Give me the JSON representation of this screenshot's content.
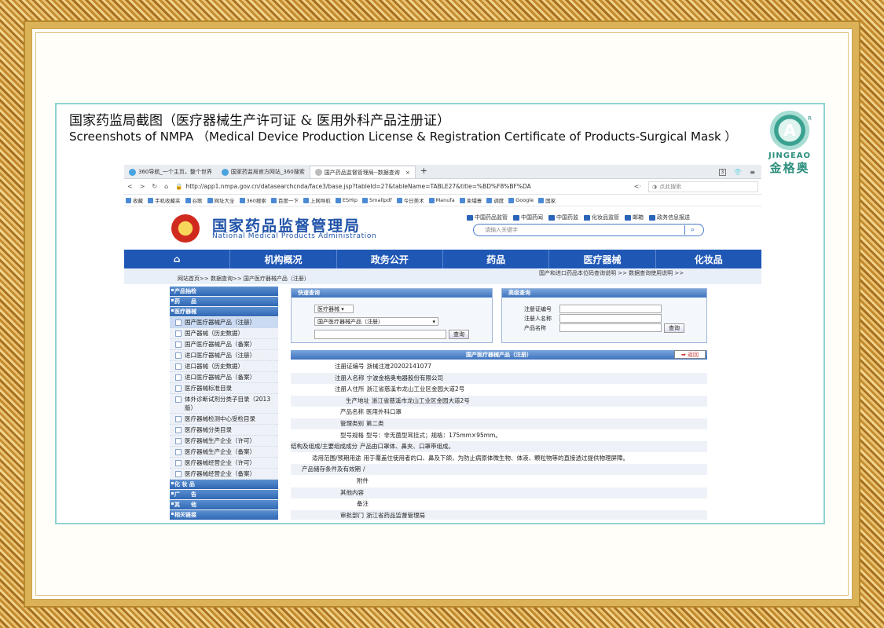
{
  "caption": {
    "cn": "国家药监局截图（医疗器械生产许可证 & 医用外科产品注册证）",
    "en": "Screenshots of NMPA （Medical Device Production License & Registration Certificate of Products-Surgical Mask ）"
  },
  "logo": {
    "en": "JINGEAO",
    "cn": "金格奥",
    "mark": "R"
  },
  "browser": {
    "tabs": [
      "360导航_一个主页，整个世界",
      "国家药监局官方网站_360搜索",
      "国产药品监督管理局--数据查询"
    ],
    "tab_close": "×",
    "tab_new": "+",
    "tab_count": "3",
    "url": "http://app1.nmpa.gov.cn/datasearchcnda/face3/base.jsp?tableId=27&tableName=TABLE27&title=%BD%F8%BF%DA",
    "search_placeholder": "点此搜索",
    "bookmarks": [
      "收藏",
      "手机收藏夹",
      "谷歌",
      "网址大全",
      "360搜索",
      "百度一下",
      "上网导航",
      "ESHip",
      "Smallpdf",
      "今日美术",
      "Manufa",
      "柬埔寨",
      "调度",
      "Google",
      "国家"
    ]
  },
  "site": {
    "title": "国家药品监督管理局",
    "subtitle": "National Medical Products Administration",
    "quick_links": [
      "中国药品监管",
      "中国药闻",
      "中国药监",
      "化妆品监管",
      "邮箱",
      "政务信息报送"
    ],
    "search_placeholder": "请输入关键字",
    "nav": [
      "⌂",
      "机构概况",
      "政务公开",
      "药品",
      "医疗器械",
      "化妆品"
    ],
    "breadcrumb": "网站首页>> 数据查询>> 国产医疗器械产品（注册）",
    "right_links": "国产和进口药品本位码查询说明 >>      数据查询使用说明 >>"
  },
  "sidebar": {
    "sections": [
      {
        "head": "产品抽检",
        "items": []
      },
      {
        "head": "药　　品",
        "items": []
      },
      {
        "head": "医疗器械",
        "items": [
          "国产医疗器械产品（注册）",
          "国产器械（历史数据）",
          "国产医疗器械产品（备案）",
          "进口医疗器械产品（注册）",
          "进口器械（历史数据）",
          "进口医疗器械产品（备案）",
          "医疗器械标准目录",
          "体外诊断试剂分类子目录（2013版）",
          "医疗器械检测中心受检目录",
          "医疗器械分类目录",
          "医疗器械生产企业（许可）",
          "医疗器械生产企业（备案）",
          "医疗器械经营企业（许可）",
          "医疗器械经营企业（备案）"
        ]
      },
      {
        "head": "化 妆 品",
        "items": []
      },
      {
        "head": "广　　告",
        "items": []
      },
      {
        "head": "其　　他",
        "items": []
      },
      {
        "head": "相关链接",
        "items": []
      }
    ]
  },
  "quick_search": {
    "title": "快速查询",
    "select1": "医疗器械 ▾",
    "select2": "国产医疗器械产品（注册）",
    "button": "查询"
  },
  "advanced_search": {
    "title": "高级查询",
    "labels": [
      "注册证编号",
      "注册人名称",
      "产品名称"
    ],
    "button": "查询"
  },
  "detail": {
    "title": "国产医疗器械产品（注册）",
    "back": "➡ 返回",
    "rows": [
      {
        "k": "注册证编号",
        "v": "浙械注准20202141077"
      },
      {
        "k": "注册人名称",
        "v": "宁波金格奥电器股份有限公司"
      },
      {
        "k": "注册人住所",
        "v": "浙江省慈溪市龙山工业区金园大道2号"
      },
      {
        "k": "生产地址",
        "v": "浙江省慈溪市龙山工业区金园大道2号"
      },
      {
        "k": "产品名称",
        "v": "医用外科口罩"
      },
      {
        "k": "管理类别",
        "v": "第二类"
      },
      {
        "k": "型号规格",
        "v": "型号：非无菌型耳挂式；规格：175mm×95mm。"
      },
      {
        "k": "结构及组成/主要组成成分",
        "v": "产品由口罩体、鼻夹、口罩带组成。"
      },
      {
        "k": "适用范围/预期用途",
        "v": "用于覆盖住使用者的口、鼻及下颌，为防止病原体微生物、体液、颗粒物等的直接透过提供物理屏障。"
      },
      {
        "k": "产品储存条件及有效期",
        "v": "/"
      },
      {
        "k": "附件",
        "v": ""
      },
      {
        "k": "其他内容",
        "v": ""
      },
      {
        "k": "备注",
        "v": ""
      },
      {
        "k": "审批部门",
        "v": "浙江省药品监督管理局"
      }
    ]
  }
}
